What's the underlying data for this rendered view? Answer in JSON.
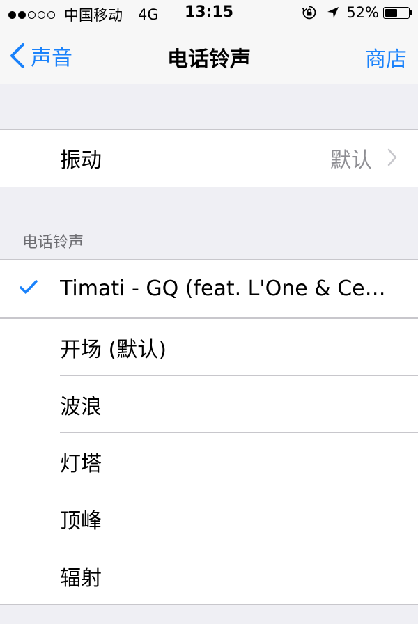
{
  "status_bar": {
    "signal_dots_filled": 2,
    "signal_dots_total": 5,
    "carrier": "中国移动",
    "network": "4G",
    "time": "13:15",
    "battery_percent": "52%",
    "battery_level": 0.52,
    "icons": [
      "orientation-lock-icon",
      "location-arrow-icon",
      "battery-icon"
    ]
  },
  "nav": {
    "back_label": "声音",
    "title": "电话铃声",
    "right_label": "商店"
  },
  "vibration_row": {
    "label": "振动",
    "value": "默认"
  },
  "ringtone_section": {
    "header": "电话铃声",
    "selected": "Timati - GQ (feat. L'One & Серг...",
    "items": [
      "开场 (默认)",
      "波浪",
      "灯塔",
      "顶峰",
      "辐射"
    ]
  },
  "colors": {
    "accent": "#1a82fb",
    "background": "#efeff4",
    "secondary_text": "#8e8e93"
  }
}
